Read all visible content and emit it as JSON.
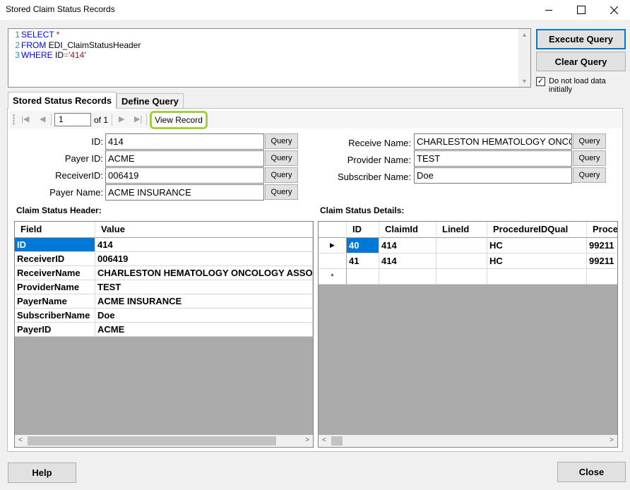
{
  "window": {
    "title": "Stored Claim Status Records"
  },
  "query": {
    "lines": [
      {
        "num": "1",
        "parts": [
          {
            "t": "SELECT",
            "c": "kw"
          },
          {
            "t": " *",
            "c": "str"
          }
        ]
      },
      {
        "num": "2",
        "parts": [
          {
            "t": "FROM",
            "c": "kw"
          },
          {
            "t": " EDI_ClaimStatusHeader",
            "c": "plain"
          }
        ]
      },
      {
        "num": "3",
        "parts": [
          {
            "t": "WHERE",
            "c": "kw"
          },
          {
            "t": " ID",
            "c": "plain"
          },
          {
            "t": "=",
            "c": "op"
          },
          {
            "t": "'414'",
            "c": "str"
          }
        ]
      }
    ]
  },
  "buttons": {
    "execute": "Execute Query",
    "clear": "Clear Query",
    "help": "Help",
    "close": "Close"
  },
  "options": {
    "no_load_label": "Do not load data initially",
    "no_load_checked": true
  },
  "tabs": {
    "stored": "Stored Status Records",
    "define": "Define Query"
  },
  "navigator": {
    "position": "1",
    "of_label": "of 1",
    "view_record": "View Record"
  },
  "fields": {
    "query_label": "Query",
    "left": [
      {
        "label": "ID:",
        "value": "414"
      },
      {
        "label": "Payer ID:",
        "value": "ACME"
      },
      {
        "label": "ReceiverID:",
        "value": "006419"
      },
      {
        "label": "Payer Name:",
        "value": "ACME INSURANCE"
      }
    ],
    "right": [
      {
        "label": "Receive Name:",
        "value": "CHARLESTON HEMATOLOGY ONCOLOGY ASSOCIATES"
      },
      {
        "label": "Provider Name:",
        "value": "TEST"
      },
      {
        "label": "Subscriber Name:",
        "value": "Doe"
      }
    ]
  },
  "header_grid": {
    "title": "Claim Status Header:",
    "columns": [
      "Field",
      "Value"
    ],
    "rows": [
      [
        "ID",
        "414"
      ],
      [
        "ReceiverID",
        "006419"
      ],
      [
        "ReceiverName",
        "CHARLESTON HEMATOLOGY ONCOLOGY ASSOCIATES"
      ],
      [
        "ProviderName",
        "TEST"
      ],
      [
        "PayerName",
        "ACME INSURANCE"
      ],
      [
        "SubscriberName",
        "Doe"
      ],
      [
        "PayerID",
        "ACME"
      ]
    ]
  },
  "details_grid": {
    "title": "Claim Status Details:",
    "columns": [
      "ID",
      "ClaimId",
      "LineId",
      "ProcedureIDQual",
      "ProcedureCode"
    ],
    "rows": [
      [
        "40",
        "414",
        "",
        "HC",
        "99211"
      ],
      [
        "41",
        "414",
        "",
        "HC",
        "99211"
      ]
    ],
    "current_marker": "▶",
    "new_row_marker": "*"
  },
  "colors": {
    "accent": "#0078d7",
    "highlight": "#a3d13b"
  }
}
